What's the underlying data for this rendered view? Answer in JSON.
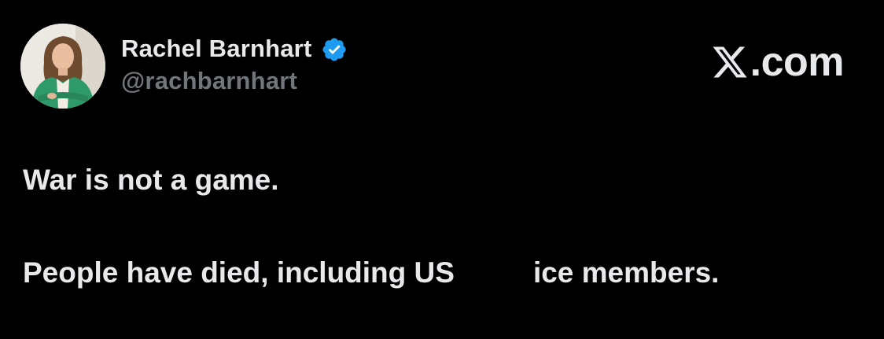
{
  "author": {
    "display_name": "Rachel Barnhart",
    "handle": "@rachbarnhart",
    "verified": true
  },
  "brand": {
    "text": ".com",
    "icon": "x-logo-icon"
  },
  "tweet": {
    "line1": "War is not a game.",
    "line2_part1": "People have died, including US",
    "line2_part2": "ice members."
  },
  "colors": {
    "background": "#000000",
    "primary_text": "#e7e9ea",
    "secondary_text": "#71767b",
    "verified_blue": "#1d9bf0"
  }
}
